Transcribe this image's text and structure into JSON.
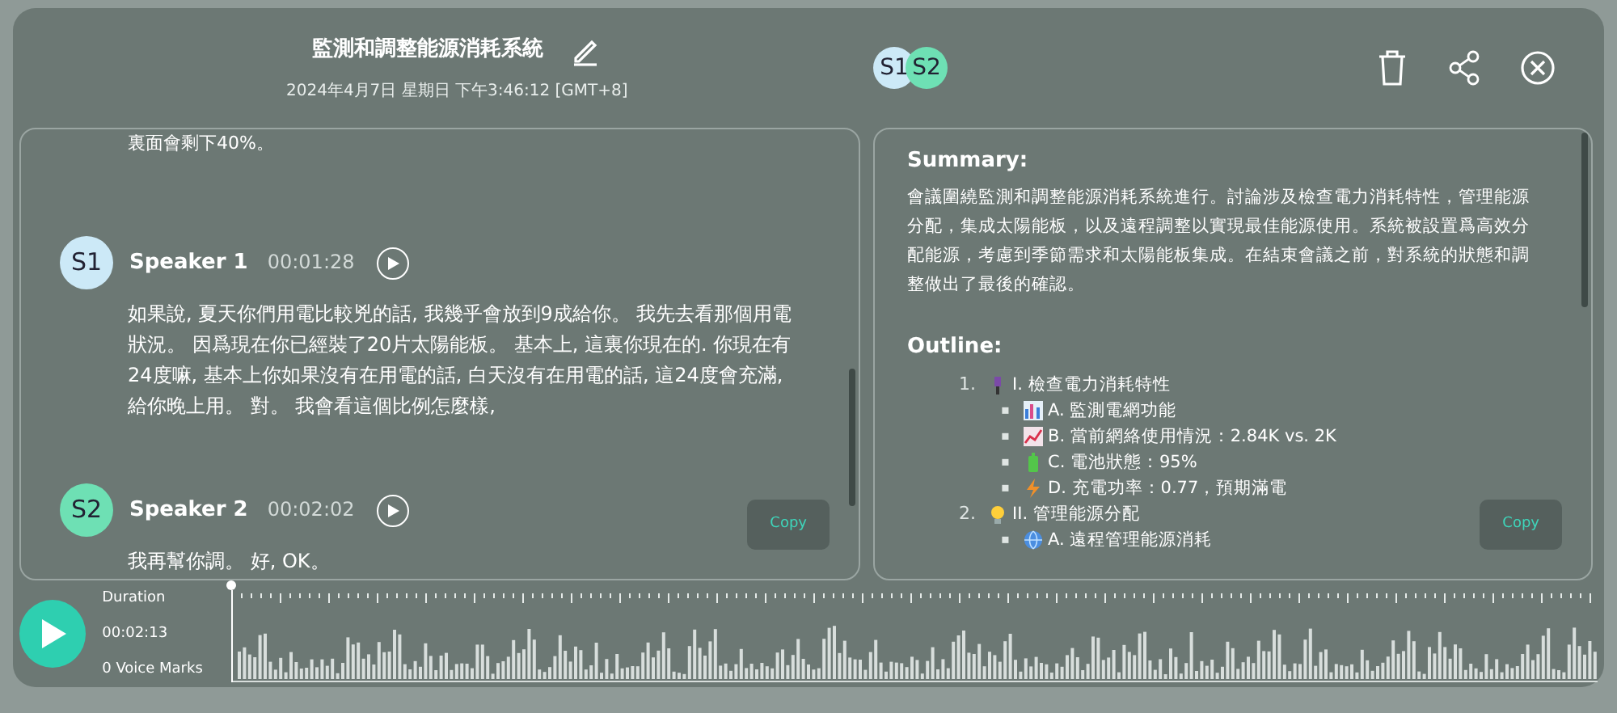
{
  "header": {
    "title": "監測和調整能源消耗系統",
    "datetime": "2024年4月7日 星期日 下午3:46:12 [GMT+8]"
  },
  "participants": [
    {
      "label": "S1",
      "color": "#cce9f7"
    },
    {
      "label": "S2",
      "color": "#6ee0b4"
    }
  ],
  "transcript": [
    {
      "kind": "text",
      "text": "裏面會剩下40%。"
    },
    {
      "kind": "segment",
      "avatar": "S1",
      "color": "#cce9f7",
      "speaker": "Speaker 1",
      "time": "00:01:28",
      "text": "如果說, 夏天你們用電比較兇的話, 我幾乎會放到9成給你。 我先去看那個用電狀況。 因爲現在你已經裝了20片太陽能板。 基本上, 這裏你現在的. 你現在有24度嘛, 基本上你如果沒有在用電的話, 白天沒有在用電的話, 這24度會充滿, 給你晚上用。 對。 我會看這個比例怎麼樣,"
    },
    {
      "kind": "segment",
      "avatar": "S2",
      "color": "#6ee0b4",
      "speaker": "Speaker 2",
      "time": "00:02:02",
      "text": "我再幫你調。 好, OK。"
    }
  ],
  "transcript_copy": "Copy",
  "summary": {
    "heading": "Summary:",
    "text": "會議圍繞監測和調整能源消耗系統進行。討論涉及檢查電力消耗特性，管理能源分配，集成太陽能板，以及遠程調整以實現最佳能源使用。系統被設置爲高效分配能源，考慮到季節需求和太陽能板集成。在結束會議之前，對系統的狀態和調整做出了最後的確認。"
  },
  "outline": {
    "heading": "Outline:",
    "items": [
      {
        "marker": "1.",
        "text": "I. 檢查電力消耗特性",
        "children": [
          {
            "marker": "▪",
            "text": "A. 監測電網功能"
          },
          {
            "marker": "▪",
            "text": "B. 當前網絡使用情況：2.84K vs. 2K"
          },
          {
            "marker": "▪",
            "text": "C. 電池狀態：95%"
          },
          {
            "marker": "▪",
            "text": "D. 充電功率：0.77，預期滿電"
          }
        ]
      },
      {
        "marker": "2.",
        "text": "II. 管理能源分配",
        "children": [
          {
            "marker": "▪",
            "text": "A. 遠程管理能源消耗"
          }
        ]
      }
    ]
  },
  "summary_copy": "Copy",
  "player": {
    "duration_label": "Duration",
    "duration": "00:02:13",
    "voice_marks": "0 Voice Marks",
    "level": 0
  }
}
